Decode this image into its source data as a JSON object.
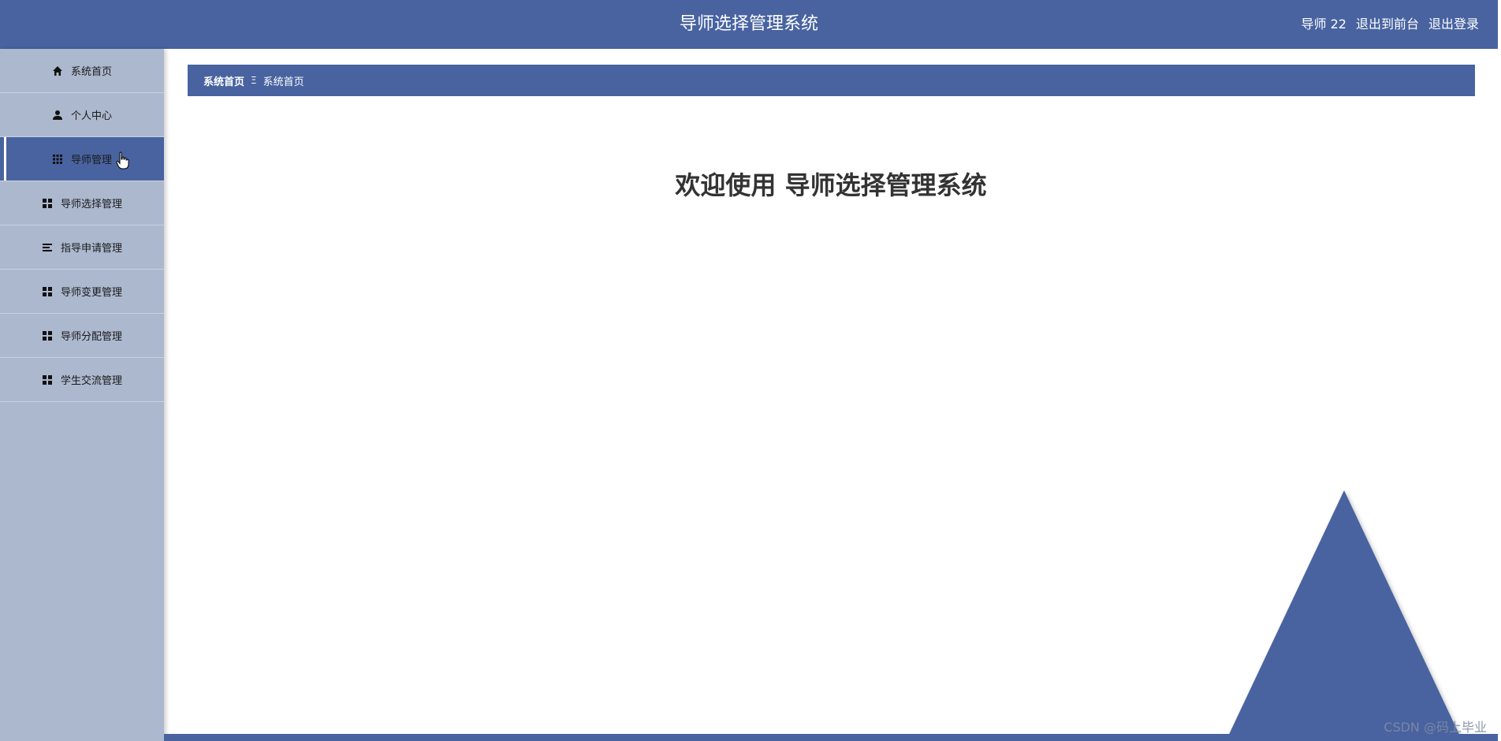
{
  "header": {
    "title": "导师选择管理系统",
    "user_label": "导师 22",
    "to_front_link": "退出到前台",
    "logout_link": "退出登录"
  },
  "sidebar": {
    "items": [
      {
        "label": "系统首页",
        "icon": "home-icon"
      },
      {
        "label": "个人中心",
        "icon": "user-icon"
      },
      {
        "label": "导师管理",
        "icon": "grid-icon",
        "active": true
      },
      {
        "label": "导师选择管理",
        "icon": "apps-icon"
      },
      {
        "label": "指导申请管理",
        "icon": "list-icon"
      },
      {
        "label": "导师变更管理",
        "icon": "apps-icon"
      },
      {
        "label": "导师分配管理",
        "icon": "apps-icon"
      },
      {
        "label": "学生交流管理",
        "icon": "apps-icon"
      }
    ]
  },
  "breadcrumb": {
    "home": "系统首页",
    "separator": "Ξ",
    "current": "系统首页"
  },
  "main": {
    "welcome": "欢迎使用 导师选择管理系统"
  },
  "watermark": "CSDN @码上毕业",
  "colors": {
    "primary": "#4863a0",
    "sidebar_bg": "#acb8ce",
    "text_dark": "#333333"
  }
}
